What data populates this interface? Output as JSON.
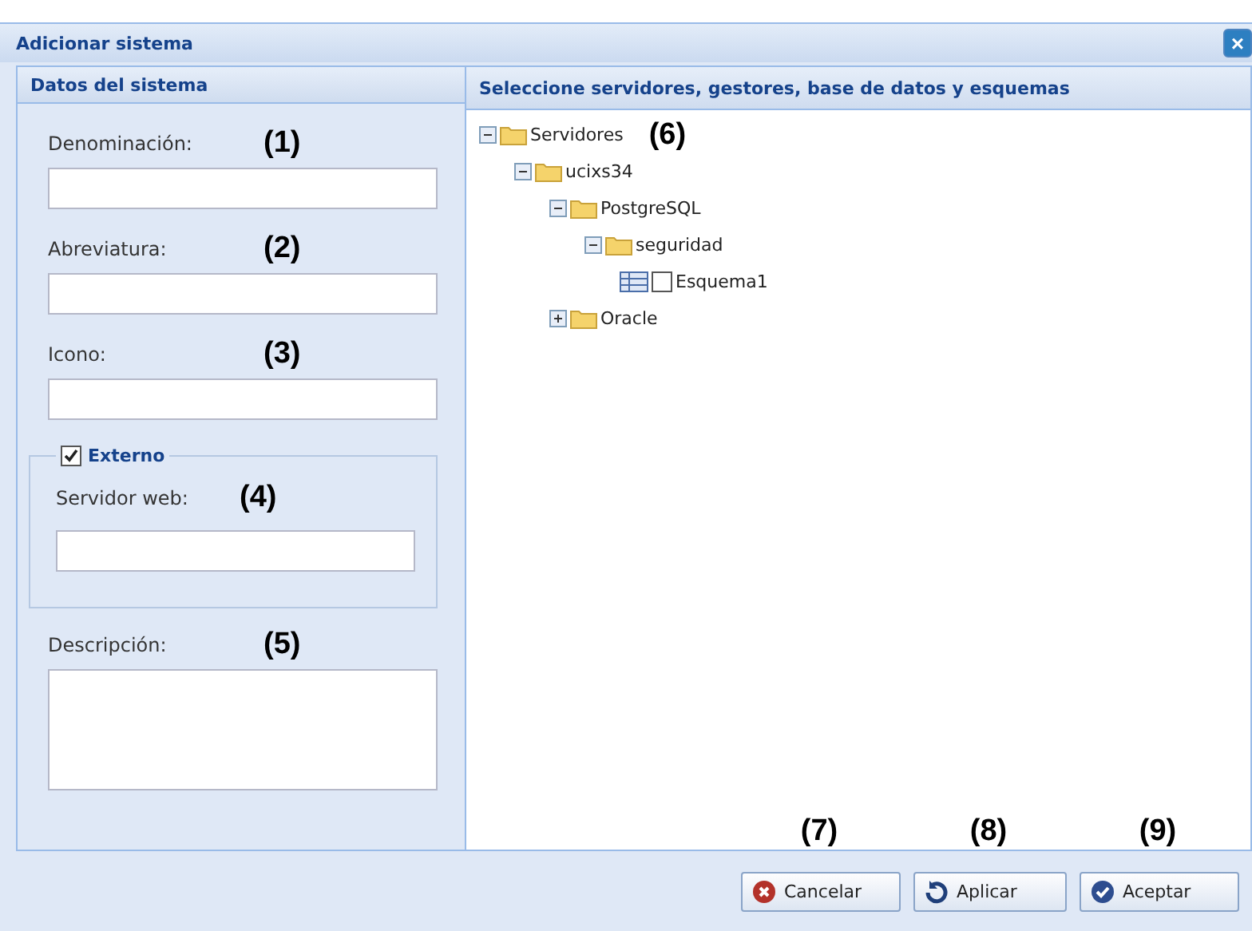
{
  "window": {
    "title": "Adicionar sistema",
    "close": "×"
  },
  "left_panel": {
    "title": "Datos del sistema",
    "fields": [
      {
        "kind": "input",
        "label": "Denominación:",
        "note": "(1)"
      },
      {
        "kind": "input",
        "label": "Abreviatura:",
        "note": "(2)"
      },
      {
        "kind": "input",
        "label": "Icono:",
        "note": "(3)"
      },
      {
        "kind": "group",
        "legend": "Externo",
        "checked": true,
        "label": "Servidor web:",
        "note": "(4)"
      },
      {
        "kind": "textarea",
        "label": "Descripción:",
        "note": "(5)"
      }
    ]
  },
  "right_panel": {
    "title": "Seleccione servidores, gestores, base de datos y esquemas",
    "note": "(6)",
    "tree": [
      {
        "label": "Servidores",
        "kind": "folder",
        "expanded": true,
        "children": [
          {
            "label": "ucixs34",
            "kind": "folder",
            "expanded": true,
            "children": [
              {
                "label": "PostgreSQL",
                "kind": "folder",
                "expanded": true,
                "children": [
                  {
                    "label": "seguridad",
                    "kind": "folder",
                    "expanded": true,
                    "children": [
                      {
                        "label": "Esquema1",
                        "kind": "schema",
                        "checked": false
                      }
                    ]
                  }
                ]
              },
              {
                "label": "Oracle",
                "kind": "folder",
                "expanded": false
              }
            ]
          }
        ]
      }
    ]
  },
  "buttons": [
    {
      "label": "Cancelar",
      "kind": "cancel",
      "note": "(7)"
    },
    {
      "label": "Aplicar",
      "kind": "apply",
      "note": "(8)"
    },
    {
      "label": "Aceptar",
      "kind": "accept",
      "note": "(9)"
    }
  ]
}
